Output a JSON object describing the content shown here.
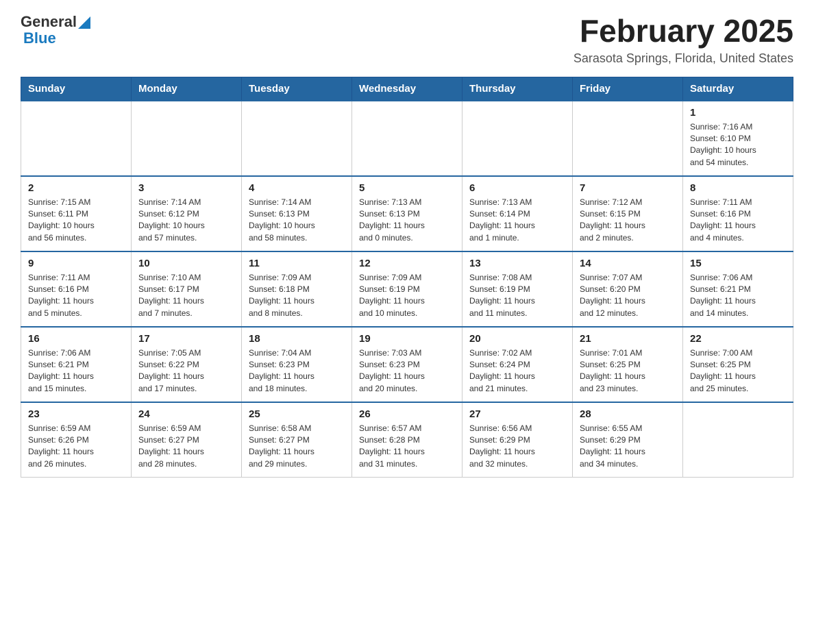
{
  "header": {
    "logo_general": "General",
    "logo_blue": "Blue",
    "month_title": "February 2025",
    "location": "Sarasota Springs, Florida, United States"
  },
  "weekdays": [
    "Sunday",
    "Monday",
    "Tuesday",
    "Wednesday",
    "Thursday",
    "Friday",
    "Saturday"
  ],
  "weeks": [
    [
      {
        "day": "",
        "info": ""
      },
      {
        "day": "",
        "info": ""
      },
      {
        "day": "",
        "info": ""
      },
      {
        "day": "",
        "info": ""
      },
      {
        "day": "",
        "info": ""
      },
      {
        "day": "",
        "info": ""
      },
      {
        "day": "1",
        "info": "Sunrise: 7:16 AM\nSunset: 6:10 PM\nDaylight: 10 hours\nand 54 minutes."
      }
    ],
    [
      {
        "day": "2",
        "info": "Sunrise: 7:15 AM\nSunset: 6:11 PM\nDaylight: 10 hours\nand 56 minutes."
      },
      {
        "day": "3",
        "info": "Sunrise: 7:14 AM\nSunset: 6:12 PM\nDaylight: 10 hours\nand 57 minutes."
      },
      {
        "day": "4",
        "info": "Sunrise: 7:14 AM\nSunset: 6:13 PM\nDaylight: 10 hours\nand 58 minutes."
      },
      {
        "day": "5",
        "info": "Sunrise: 7:13 AM\nSunset: 6:13 PM\nDaylight: 11 hours\nand 0 minutes."
      },
      {
        "day": "6",
        "info": "Sunrise: 7:13 AM\nSunset: 6:14 PM\nDaylight: 11 hours\nand 1 minute."
      },
      {
        "day": "7",
        "info": "Sunrise: 7:12 AM\nSunset: 6:15 PM\nDaylight: 11 hours\nand 2 minutes."
      },
      {
        "day": "8",
        "info": "Sunrise: 7:11 AM\nSunset: 6:16 PM\nDaylight: 11 hours\nand 4 minutes."
      }
    ],
    [
      {
        "day": "9",
        "info": "Sunrise: 7:11 AM\nSunset: 6:16 PM\nDaylight: 11 hours\nand 5 minutes."
      },
      {
        "day": "10",
        "info": "Sunrise: 7:10 AM\nSunset: 6:17 PM\nDaylight: 11 hours\nand 7 minutes."
      },
      {
        "day": "11",
        "info": "Sunrise: 7:09 AM\nSunset: 6:18 PM\nDaylight: 11 hours\nand 8 minutes."
      },
      {
        "day": "12",
        "info": "Sunrise: 7:09 AM\nSunset: 6:19 PM\nDaylight: 11 hours\nand 10 minutes."
      },
      {
        "day": "13",
        "info": "Sunrise: 7:08 AM\nSunset: 6:19 PM\nDaylight: 11 hours\nand 11 minutes."
      },
      {
        "day": "14",
        "info": "Sunrise: 7:07 AM\nSunset: 6:20 PM\nDaylight: 11 hours\nand 12 minutes."
      },
      {
        "day": "15",
        "info": "Sunrise: 7:06 AM\nSunset: 6:21 PM\nDaylight: 11 hours\nand 14 minutes."
      }
    ],
    [
      {
        "day": "16",
        "info": "Sunrise: 7:06 AM\nSunset: 6:21 PM\nDaylight: 11 hours\nand 15 minutes."
      },
      {
        "day": "17",
        "info": "Sunrise: 7:05 AM\nSunset: 6:22 PM\nDaylight: 11 hours\nand 17 minutes."
      },
      {
        "day": "18",
        "info": "Sunrise: 7:04 AM\nSunset: 6:23 PM\nDaylight: 11 hours\nand 18 minutes."
      },
      {
        "day": "19",
        "info": "Sunrise: 7:03 AM\nSunset: 6:23 PM\nDaylight: 11 hours\nand 20 minutes."
      },
      {
        "day": "20",
        "info": "Sunrise: 7:02 AM\nSunset: 6:24 PM\nDaylight: 11 hours\nand 21 minutes."
      },
      {
        "day": "21",
        "info": "Sunrise: 7:01 AM\nSunset: 6:25 PM\nDaylight: 11 hours\nand 23 minutes."
      },
      {
        "day": "22",
        "info": "Sunrise: 7:00 AM\nSunset: 6:25 PM\nDaylight: 11 hours\nand 25 minutes."
      }
    ],
    [
      {
        "day": "23",
        "info": "Sunrise: 6:59 AM\nSunset: 6:26 PM\nDaylight: 11 hours\nand 26 minutes."
      },
      {
        "day": "24",
        "info": "Sunrise: 6:59 AM\nSunset: 6:27 PM\nDaylight: 11 hours\nand 28 minutes."
      },
      {
        "day": "25",
        "info": "Sunrise: 6:58 AM\nSunset: 6:27 PM\nDaylight: 11 hours\nand 29 minutes."
      },
      {
        "day": "26",
        "info": "Sunrise: 6:57 AM\nSunset: 6:28 PM\nDaylight: 11 hours\nand 31 minutes."
      },
      {
        "day": "27",
        "info": "Sunrise: 6:56 AM\nSunset: 6:29 PM\nDaylight: 11 hours\nand 32 minutes."
      },
      {
        "day": "28",
        "info": "Sunrise: 6:55 AM\nSunset: 6:29 PM\nDaylight: 11 hours\nand 34 minutes."
      },
      {
        "day": "",
        "info": ""
      }
    ]
  ]
}
